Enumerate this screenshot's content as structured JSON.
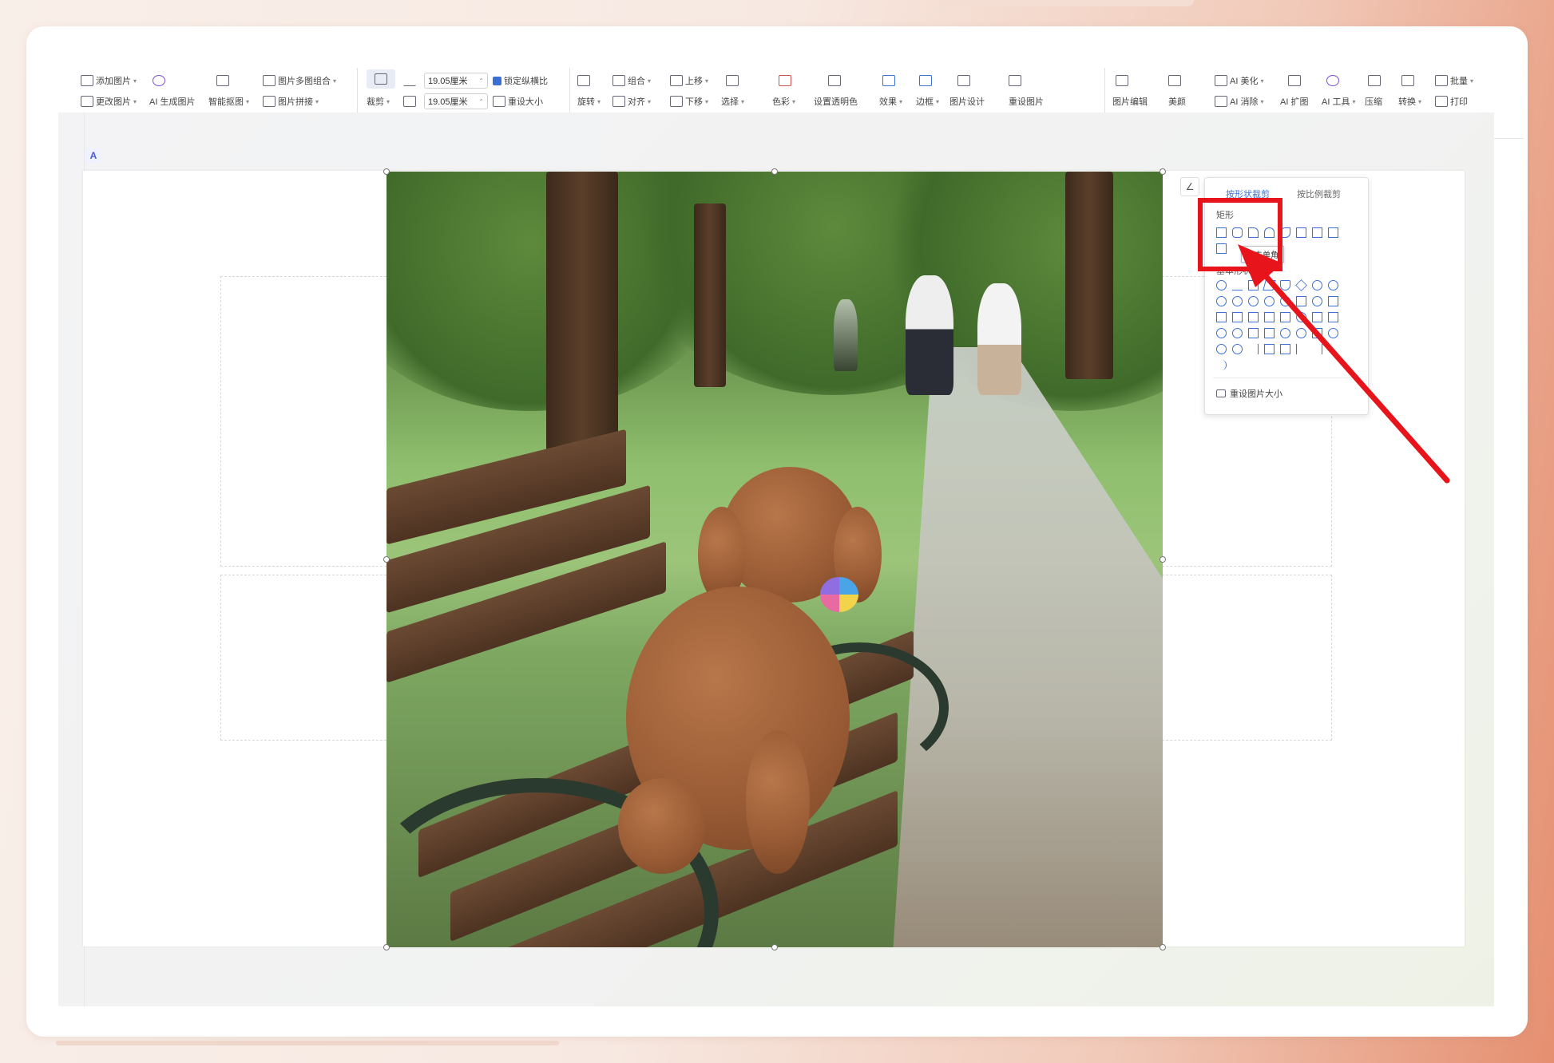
{
  "ribbon": {
    "groups": [
      {
        "buttons": [
          {
            "label": "添加图片",
            "icon": "add-image-icon"
          },
          {
            "label": "更改图片",
            "icon": "change-image-icon"
          },
          {
            "label": "AI 生成图片",
            "icon": "ai-generate-icon"
          },
          {
            "label": "智能抠图",
            "icon": "smart-cutout-icon"
          },
          {
            "label": "图片多图组合",
            "icon": "multi-image-icon"
          },
          {
            "label": "图片拼接",
            "icon": "image-splice-icon"
          }
        ]
      },
      {
        "crop_label": "裁剪",
        "width_value": "19.05厘米",
        "height_value": "19.05厘米",
        "lock_ratio_label": "锁定纵横比",
        "lock_ratio_checked": true,
        "reset_size_label": "重设大小"
      },
      {
        "buttons": [
          {
            "label": "旋转"
          },
          {
            "label": "组合"
          },
          {
            "label": "对齐"
          },
          {
            "label": "上移"
          },
          {
            "label": "下移"
          },
          {
            "label": "选择"
          }
        ]
      },
      {
        "buttons": [
          {
            "label": "色彩"
          },
          {
            "label": "设置透明色"
          },
          {
            "label": "效果"
          },
          {
            "label": "边框"
          },
          {
            "label": "图片设计"
          },
          {
            "label": "重设图片"
          }
        ]
      },
      {
        "buttons": [
          {
            "label": "图片编辑"
          },
          {
            "label": "美颜"
          },
          {
            "label": "AI 美化"
          },
          {
            "label": "AI 消除"
          },
          {
            "label": "AI 扩图"
          },
          {
            "label": "AI 工具"
          },
          {
            "label": "压缩"
          },
          {
            "label": "转换"
          },
          {
            "label": "批量"
          },
          {
            "label": "打印"
          }
        ]
      }
    ]
  },
  "crop_panel": {
    "tabs": [
      "按形状裁剪",
      "按比例裁剪"
    ],
    "section_rect": "矩形",
    "section_basic": "基本形状",
    "tooltip": "剪去单角",
    "reset_label": "重设图片大小"
  },
  "colors": {
    "accent": "#3b6fd6",
    "annotation": "#e8141b"
  }
}
